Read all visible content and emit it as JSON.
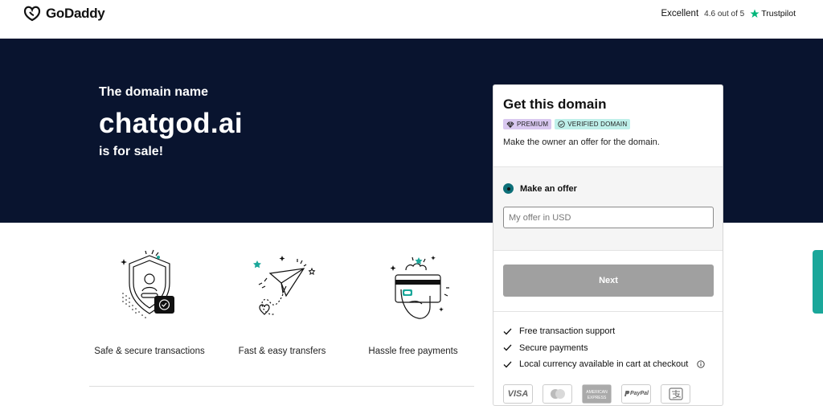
{
  "header": {
    "logo_text": "GoDaddy",
    "rating_label": "Excellent",
    "rating_score": "4.6 out of 5",
    "rating_provider": "Trustpilot"
  },
  "hero": {
    "intro": "The domain name",
    "domain": "chatgod.ai",
    "outro": "is for sale!"
  },
  "features": [
    {
      "label": "Safe & secure transactions",
      "icon": "shield-icon"
    },
    {
      "label": "Fast & easy transfers",
      "icon": "paper-plane-icon"
    },
    {
      "label": "Hassle free payments",
      "icon": "card-payment-icon"
    }
  ],
  "card": {
    "title": "Get this domain",
    "badges": {
      "premium": "PREMIUM",
      "verified": "VERIFIED DOMAIN"
    },
    "description": "Make the owner an offer for the domain.",
    "option_label": "Make an offer",
    "offer_placeholder": "My offer in USD",
    "next_label": "Next",
    "benefits": [
      "Free transaction support",
      "Secure payments",
      "Local currency available in cart at checkout"
    ],
    "payment_methods": [
      "VISA",
      "mastercard",
      "American Express",
      "PayPal",
      "Alipay"
    ]
  },
  "colors": {
    "hero_bg": "#09142f",
    "accent_teal": "#1aa79a",
    "next_disabled": "#a0a0a0"
  }
}
